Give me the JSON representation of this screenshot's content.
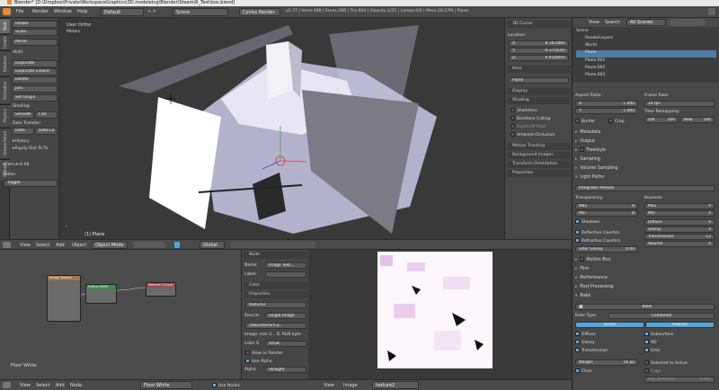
{
  "window": {
    "title": "Blender* [D:\\Dropbox\\Private\\WorkspaceGraphics\\3D modeleing\\Blender\\Steam\\R_Test\\box.blend]"
  },
  "topbar": {
    "menus": [
      "File",
      "Render",
      "Window",
      "Help"
    ],
    "layout": "Default",
    "scene": "Scene",
    "engine": "Cycles Render",
    "info": "v2.77 | Verts:488 | Faces:288 | Tris:804 | Objects:1/25 | Lamps:0/0 | Mem:28.57M | Plane"
  },
  "toolshelf_tabs": [
    "Tools",
    "Create",
    "Relations",
    "Animation",
    "Physics",
    "Grease Pencil",
    "Options"
  ],
  "tools": {
    "buttons": [
      "Rotate",
      "Scale",
      "Mirror"
    ],
    "edit_header": "Edit",
    "edit_buttons": [
      "Duplicate",
      "Duplicate Linked",
      "Delete",
      "Join"
    ],
    "origin": "Set Origin",
    "shading_label": "Shading:",
    "smooth": "Smooth",
    "flat": "Flat",
    "data_transfer": "Data Transfer:",
    "data": "Data",
    "data_la": "Data La",
    "history": "History",
    "history_item": "Rigidy Dist To Ta",
    "operator": "Zerrulcrt.68",
    "action_label": "Action",
    "action_value": "Toggle"
  },
  "viewport": {
    "top_label": "User Ortho",
    "units": "Meters",
    "object_label": "(1) Plane"
  },
  "npanel": {
    "cursor_header": "3D Cursor",
    "location_label": "Location:",
    "x": "X:",
    "x_val": "8.16148m",
    "y": "Y:",
    "y_val": "-4.37543m",
    "z": "Z:",
    "z_val": "9.93480m",
    "item_header": "Item",
    "item_name": "Plane",
    "display_header": "Display",
    "shading_header": "Shading",
    "shading_opts": [
      "Shadeless",
      "Backface Culling",
      "Depth Of Field",
      "Ambient Occlusion"
    ],
    "motion": "Motion Tracking",
    "background": "Background Images",
    "transform": "Transform Orientation",
    "properties": "Properties"
  },
  "vheader": {
    "menus": [
      "View",
      "Select",
      "Add",
      "Object"
    ],
    "mode": "Object Mode",
    "pivot": "Global"
  },
  "nodeeditor": {
    "node1": "Image Texture",
    "node2": "Diffuse BSDF",
    "node3": "Material Output",
    "label": "Floor White"
  },
  "nodeprops": {
    "header": "Node",
    "name_label": "Name:",
    "name_value": "Image Text...",
    "label_label": "Label:",
    "color": "Color",
    "properties": "Properties",
    "texture": "texture2",
    "source_label": "Source:",
    "source_value": "Single Image",
    "file": "//box2texture.p...",
    "info": "Image: size 2... B, RGB byte",
    "cspace_label": "Color S",
    "cspace_value": "sRGB",
    "view_render": "View as Render",
    "use_alpha": "Use Alpha",
    "alpha_label": "Alpha",
    "alpha_value": "Straight"
  },
  "bottombar": {
    "menus": [
      "View",
      "Select",
      "Add",
      "Node"
    ],
    "material": "Floor White",
    "use_nodes": "Use Nodes",
    "img_menus": [
      "View",
      "Image"
    ],
    "image": "texture2"
  },
  "outliner": {
    "menus": [
      "View",
      "Search"
    ],
    "filter": "All Scenes",
    "items": [
      "Scene",
      "RenderLayers",
      "World",
      "Plane",
      "Plane.001",
      "Plane.002",
      "Plane.003"
    ]
  },
  "props": {
    "aspect_ratio": "Aspect Ratio:",
    "ax": "X:",
    "ax_val": "1.000",
    "ay": "Y:",
    "ay_val": "1.000",
    "border": "Border",
    "crop": "Crop",
    "frame_rate": "Frame Rate:",
    "fps": "24 fps",
    "time_remap": "Time Remapping:",
    "old": "Old",
    "old_val": "100",
    "new": "New",
    "new_val": "100",
    "sections": [
      "Metadata",
      "Output",
      "Freestyle",
      "Sampling",
      "Volume Sampling",
      "Light Paths"
    ],
    "presets": "Integrator Presets",
    "transparency": "Transparency:",
    "t_max": "Max",
    "t_max_val": "8",
    "t_min": "Min",
    "t_min_val": "8",
    "shadows": "Shadows",
    "refl_caustics": "Reflective Caustics",
    "refr_caustics": "Refractive Caustics",
    "filter_glossy": "Filter Glossy",
    "filter_glossy_val": "0.00",
    "bounces": "Bounces:",
    "b_max": "Max",
    "b_max_val": "4",
    "b_min": "Min",
    "b_min_val": "4",
    "diffuse": "Diffuse",
    "diffuse_val": "4",
    "glossy": "Glossy",
    "glossy_val": "4",
    "transmission": "Transmission",
    "transmission_val": "12",
    "volume": "Volume",
    "volume_val": "0",
    "sections2": [
      "Motion Blur",
      "Film",
      "Performance",
      "Post Processing"
    ],
    "bake_header": "Bake",
    "bake_button": "Bake",
    "bake_type_label": "Bake Type:",
    "bake_type": "Combined",
    "direct": "Direct",
    "indirect": "Indirect",
    "b_diffuse": "Diffuse",
    "b_subsurface": "Subsurface",
    "b_glossy": "Glossy",
    "b_ao": "AO",
    "b_transmission": "Transmission",
    "b_emit": "Emit",
    "margin": "Margin:",
    "margin_val": "16 px",
    "selected_active": "Selected to Active",
    "clear": "Clear",
    "cage": "Cage",
    "ray_distance": "Ray Distance:",
    "ray_val": "0.000"
  },
  "colors": {
    "accent": "#5ab0e8",
    "active_blue": "#4fa6e0",
    "header": "#4a4a4a",
    "panel": "#484848"
  }
}
